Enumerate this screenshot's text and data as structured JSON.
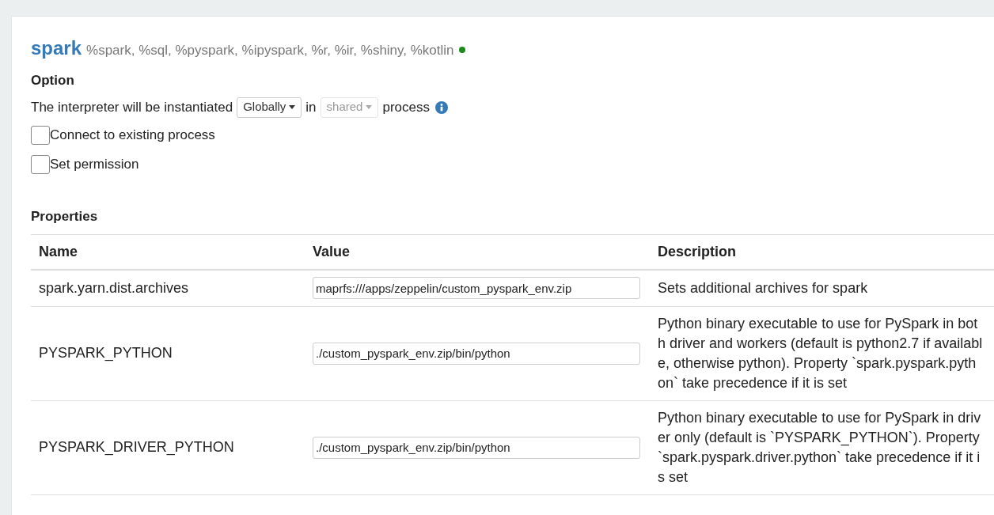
{
  "interpreter": {
    "name": "spark",
    "bindings": "%spark, %sql, %pyspark, %ipyspark, %r, %ir, %shiny, %kotlin",
    "color": "#1a8a1a"
  },
  "option": {
    "heading": "Option",
    "sentence_start": "The interpreter will be instantiated",
    "scope_dropdown": {
      "value": "Globally",
      "disabled": false
    },
    "connector": "in",
    "process_dropdown": {
      "value": "shared",
      "disabled": true
    },
    "sentence_end": "process",
    "checkboxes": [
      {
        "label": "Connect to existing process",
        "checked": false
      },
      {
        "label": "Set permission",
        "checked": false
      }
    ]
  },
  "properties": {
    "heading": "Properties",
    "columns": [
      "Name",
      "Value",
      "Description"
    ],
    "rows": [
      {
        "name": "spark.yarn.dist.archives",
        "value": "maprfs:///apps/zeppelin/custom_pyspark_env.zip",
        "description": "Sets additional archives for spark"
      },
      {
        "name": "PYSPARK_PYTHON",
        "value": "./custom_pyspark_env.zip/bin/python",
        "description": "Python binary executable to use for PySpark in both driver and workers (default is python2.7 if available, otherwise python). Property `spark.pyspark.python` take precedence if it is set"
      },
      {
        "name": "PYSPARK_DRIVER_PYTHON",
        "value": "./custom_pyspark_env.zip/bin/python",
        "description": "Python binary executable to use for PySpark in driver only (default is `PYSPARK_PYTHON`). Property `spark.pyspark.driver.python` take precedence if it is set"
      }
    ]
  }
}
